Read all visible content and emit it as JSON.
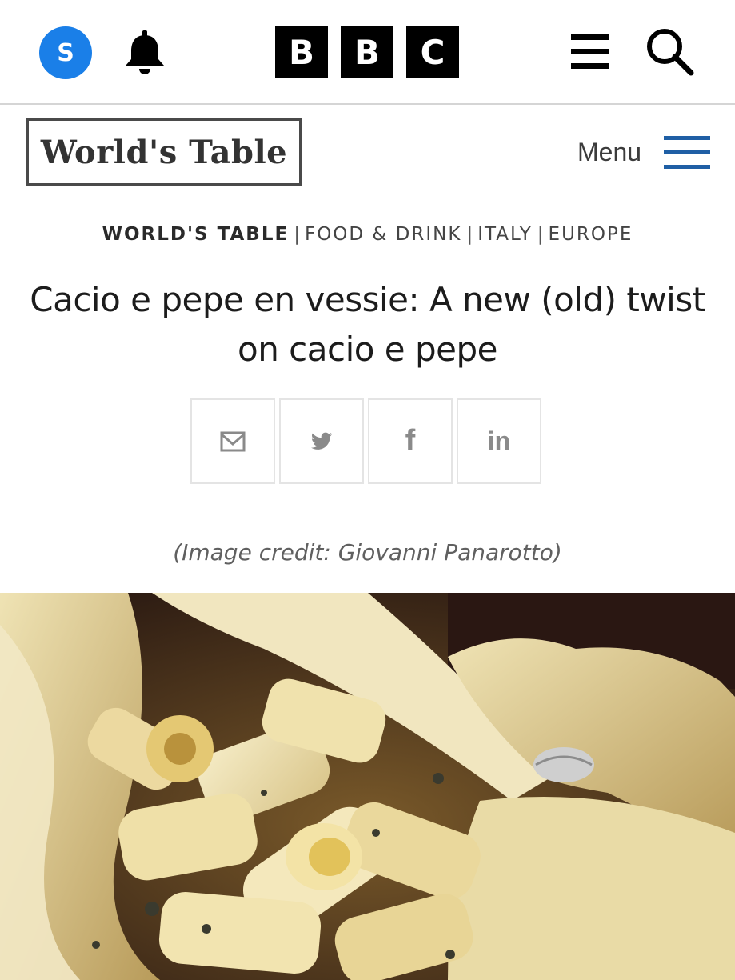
{
  "topbar": {
    "avatar_initial": "S",
    "logo_letters": [
      "B",
      "B",
      "C"
    ],
    "icons": [
      "user-avatar",
      "bell-icon",
      "menu-icon",
      "search-icon"
    ],
    "accent_color": "#1a7fe8"
  },
  "section_header": {
    "logo_text": "World's Table",
    "menu_label": "Menu",
    "menu_icon_color": "#1f5fa5"
  },
  "breadcrumb": {
    "main": "WORLD'S TABLE",
    "items": [
      "FOOD & DRINK",
      "ITALY",
      "EUROPE"
    ],
    "separator": "|"
  },
  "article": {
    "title": "Cacio e pepe en vessie: A new (old) twist on cacio e pepe",
    "image_credit": "(Image credit: Giovanni Panarotto)"
  },
  "share": {
    "buttons": [
      "email-icon",
      "twitter-icon",
      "facebook-icon",
      "linkedin-icon"
    ],
    "facebook_glyph": "f",
    "linkedin_glyph": "in"
  }
}
